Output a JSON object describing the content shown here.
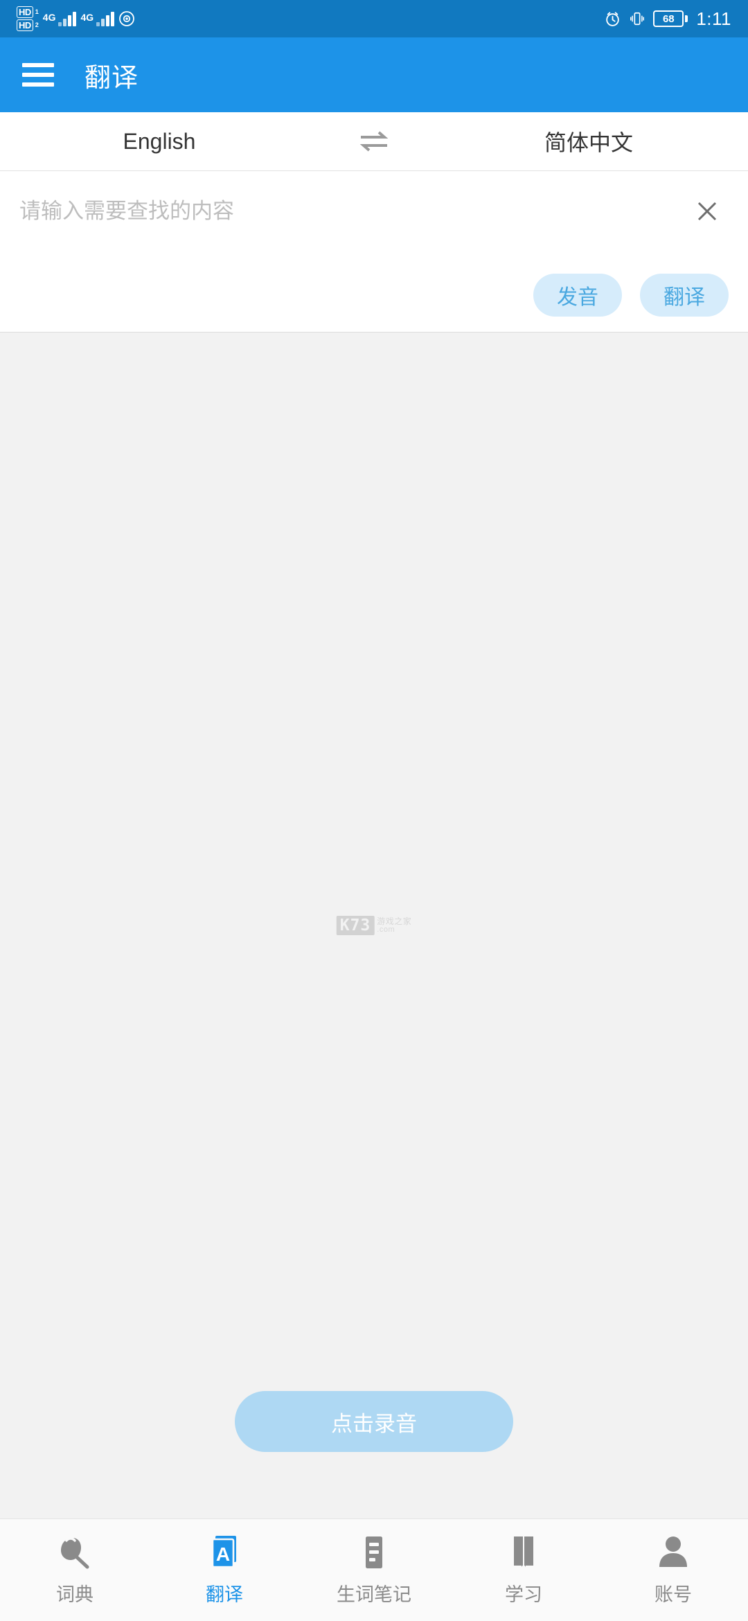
{
  "status_bar": {
    "hd_badge_primary": "HD",
    "hd_sub_primary": "1",
    "hd_badge_secondary": "HD",
    "hd_sub_secondary": "2",
    "network_label_1": "4G",
    "network_label_2": "4G",
    "eye_icon": "eye-comfort-icon",
    "alarm_icon": "alarm-icon",
    "vibrate_icon": "vibrate-icon",
    "battery_level": "68",
    "time": "1:11",
    "background_color": "#1179C0"
  },
  "app_bar": {
    "menu_icon": "hamburger-menu-icon",
    "title": "翻译",
    "background_color": "#1D93E8"
  },
  "language_selector": {
    "source_language": "English",
    "swap_icon": "swap-arrows-icon",
    "target_language": "简体中文"
  },
  "input_card": {
    "placeholder": "请输入需要查找的内容",
    "value": "",
    "clear_icon": "close-x-icon",
    "pronounce_label": "发音",
    "translate_label": "翻译",
    "pill_bg_color": "#D6ECFB",
    "pill_text_color": "#4AA8E0"
  },
  "content": {
    "watermark_box": "K73",
    "watermark_cn": "游戏之家",
    "watermark_en": ".com",
    "record_label": "点击录音",
    "record_bg_color": "#AED8F3",
    "background_color": "#F2F2F2"
  },
  "bottom_nav": {
    "active_index": 1,
    "active_color": "#1D93E8",
    "inactive_color": "#8A8A8A",
    "items": [
      {
        "label": "词典",
        "icon": "magnifier-icon"
      },
      {
        "label": "翻译",
        "icon": "translate-card-a-icon"
      },
      {
        "label": "生词笔记",
        "icon": "notes-list-icon"
      },
      {
        "label": "学习",
        "icon": "open-book-icon"
      },
      {
        "label": "账号",
        "icon": "person-account-icon"
      }
    ]
  }
}
